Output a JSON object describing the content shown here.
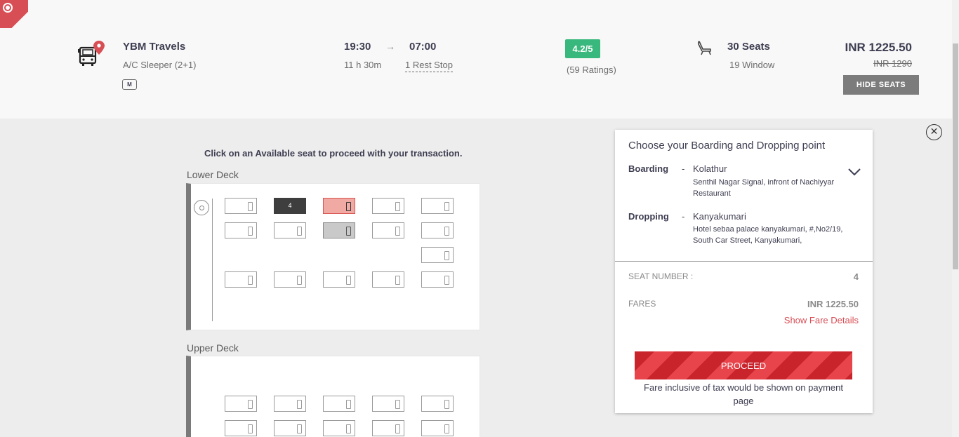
{
  "bus": {
    "operator": "YBM Travels",
    "type": "A/C Sleeper (2+1)",
    "mticket": "M",
    "departure": "19:30",
    "arrow": "→",
    "arrival": "07:00",
    "duration": "11 h 30m",
    "rest_stop": "1 Rest Stop",
    "rating": "4.2/5",
    "rating_count": "(59 Ratings)",
    "seats": "30 Seats",
    "window_seats": "19 Window",
    "price": "INR 1225.50",
    "old_price": "INR 1290",
    "hide_seats_label": "HIDE SEATS"
  },
  "layout": {
    "instruction": "Click on an Available seat to proceed with your transaction.",
    "lower_deck_label": "Lower Deck",
    "upper_deck_label": "Upper Deck",
    "selected_seat_number": "4"
  },
  "panel": {
    "title": "Choose your Boarding and Dropping point",
    "boarding_label": "Boarding",
    "dash": "-",
    "boarding_point": "Kolathur",
    "boarding_address": "Senthil Nagar Signal, infront of Nachiyyar Restaurant",
    "dropping_label": "Dropping",
    "dropping_point": "Kanyakumari",
    "dropping_address": "Hotel sebaa palace kanyakumari, #,No2/19, South Car Street, Kanyakumari,",
    "seat_number_label": "SEAT NUMBER :",
    "seat_number": "4",
    "fares_label": "FARES",
    "fares_value": "INR  1225.50",
    "fare_details_link": "Show Fare Details",
    "proceed_label": "PROCEED",
    "fare_note": "Fare inclusive of tax would be shown on payment page"
  },
  "close_symbol": "✕",
  "colors": {
    "brand_red": "#d84e55",
    "rating_green": "#38b87c",
    "ladies_seat": "#f1aaa3",
    "booked_seat": "#c9c9c9",
    "selected_seat": "#3e3e3e"
  },
  "icons": [
    "bus-location-icon",
    "seat-icon",
    "steering-wheel-icon",
    "chevron-down-icon",
    "close-icon",
    "m-ticket-icon",
    "corner-badge-icon"
  ]
}
